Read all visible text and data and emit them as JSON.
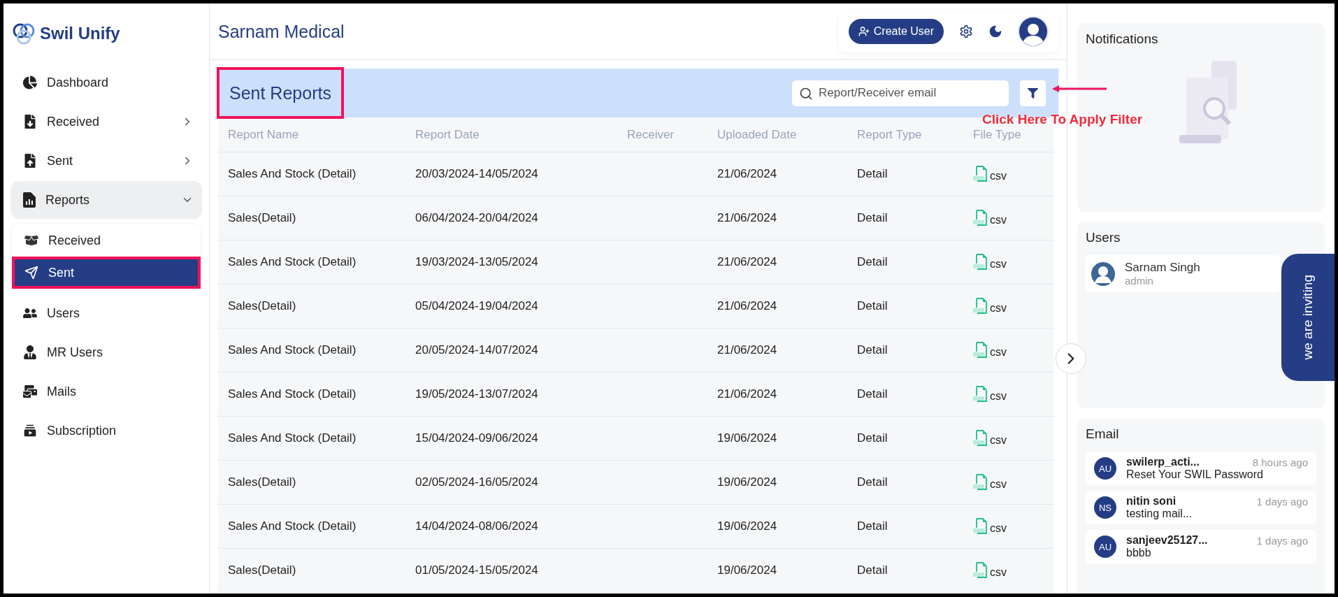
{
  "logo": {
    "text": "Swil Unify"
  },
  "sidebar": {
    "items": [
      {
        "label": "Dashboard",
        "kind": "link"
      },
      {
        "label": "Received",
        "kind": "group",
        "expanded": false
      },
      {
        "label": "Sent",
        "kind": "group",
        "expanded": false
      },
      {
        "label": "Reports",
        "kind": "group",
        "expanded": true,
        "children": [
          {
            "label": "Received",
            "selected": false,
            "highlighted": false
          },
          {
            "label": "Sent",
            "selected": true,
            "highlighted": true
          }
        ]
      },
      {
        "label": "Users",
        "kind": "link"
      },
      {
        "label": "MR Users",
        "kind": "link"
      },
      {
        "label": "Mails",
        "kind": "link"
      },
      {
        "label": "Subscription",
        "kind": "link"
      }
    ]
  },
  "header": {
    "title": "Sarnam Medical",
    "create_button": "Create User"
  },
  "panel": {
    "title": "Sent Reports",
    "highlighted": true,
    "search": {
      "placeholder": "Report/Receiver email"
    },
    "callout": "Click Here To Apply Filter"
  },
  "table": {
    "columns": [
      "Report Name",
      "Report Date",
      "Receiver",
      "Uploaded Date",
      "Report Type",
      "File Type"
    ],
    "rows": [
      [
        "Sales And Stock (Detail)",
        "20/03/2024-14/05/2024",
        "",
        "21/06/2024",
        "Detail",
        "csv"
      ],
      [
        "Sales(Detail)",
        "06/04/2024-20/04/2024",
        "",
        "21/06/2024",
        "Detail",
        "csv"
      ],
      [
        "Sales And Stock (Detail)",
        "19/03/2024-13/05/2024",
        "",
        "21/06/2024",
        "Detail",
        "csv"
      ],
      [
        "Sales(Detail)",
        "05/04/2024-19/04/2024",
        "",
        "21/06/2024",
        "Detail",
        "csv"
      ],
      [
        "Sales And Stock (Detail)",
        "20/05/2024-14/07/2024",
        "",
        "21/06/2024",
        "Detail",
        "csv"
      ],
      [
        "Sales And Stock (Detail)",
        "19/05/2024-13/07/2024",
        "",
        "21/06/2024",
        "Detail",
        "csv"
      ],
      [
        "Sales And Stock (Detail)",
        "15/04/2024-09/06/2024",
        "",
        "19/06/2024",
        "Detail",
        "csv"
      ],
      [
        "Sales(Detail)",
        "02/05/2024-16/05/2024",
        "",
        "19/06/2024",
        "Detail",
        "csv"
      ],
      [
        "Sales And Stock (Detail)",
        "14/04/2024-08/06/2024",
        "",
        "19/06/2024",
        "Detail",
        "csv"
      ],
      [
        "Sales(Detail)",
        "01/05/2024-15/05/2024",
        "",
        "19/06/2024",
        "Detail",
        "csv"
      ]
    ]
  },
  "right": {
    "notifications": {
      "title": "Notifications"
    },
    "users": {
      "title": "Users",
      "items": [
        {
          "name": "Sarnam Singh",
          "role": "admin"
        }
      ]
    },
    "email": {
      "title": "Email",
      "items": [
        {
          "initials": "AU",
          "sender": "swilerp_acti...",
          "time": "8 hours ago",
          "subject": "Reset Your SWIL Password"
        },
        {
          "initials": "NS",
          "sender": "nitin soni",
          "time": "1 days ago",
          "subject": "testing mail..."
        },
        {
          "initials": "AU",
          "sender": "sanjeev25127...",
          "time": "1 days ago",
          "subject": "bbbb"
        }
      ]
    }
  },
  "invite_tab": {
    "label": "we are inviting"
  }
}
